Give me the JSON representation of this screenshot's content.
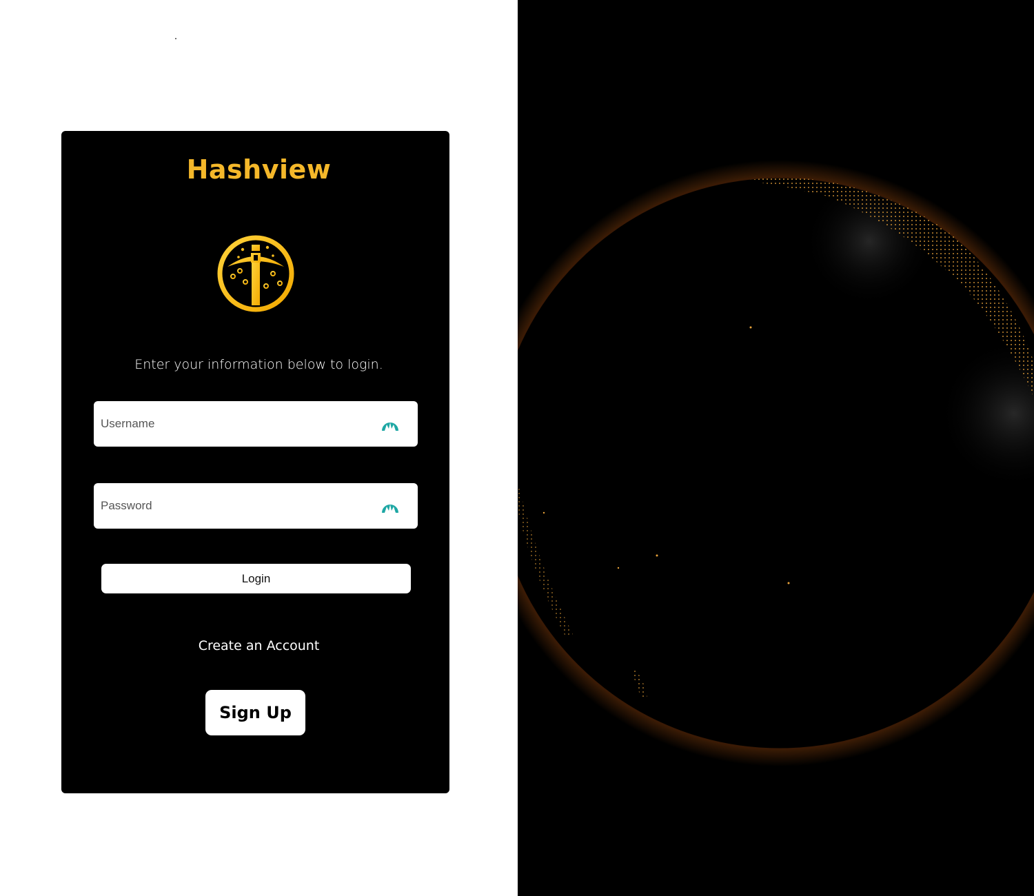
{
  "brand": {
    "title": "Hashview",
    "logo_icon": "pickaxe-coin-icon",
    "accent_color": "#f5b82a"
  },
  "login": {
    "instruction": "Enter your information below to login.",
    "username": {
      "placeholder": "Username",
      "value": "",
      "icon": "password-manager-icon",
      "icon_color": "#1ea7a4"
    },
    "password": {
      "placeholder": "Password",
      "value": "",
      "icon": "password-manager-icon",
      "icon_color": "#1ea7a4"
    },
    "login_label": "Login"
  },
  "signup": {
    "prompt": "Create an Account",
    "button_label": "Sign Up"
  },
  "background": {
    "visual": "globe-icon",
    "glow_color": "#ff7a18",
    "dot_color": "#e8a23a"
  }
}
